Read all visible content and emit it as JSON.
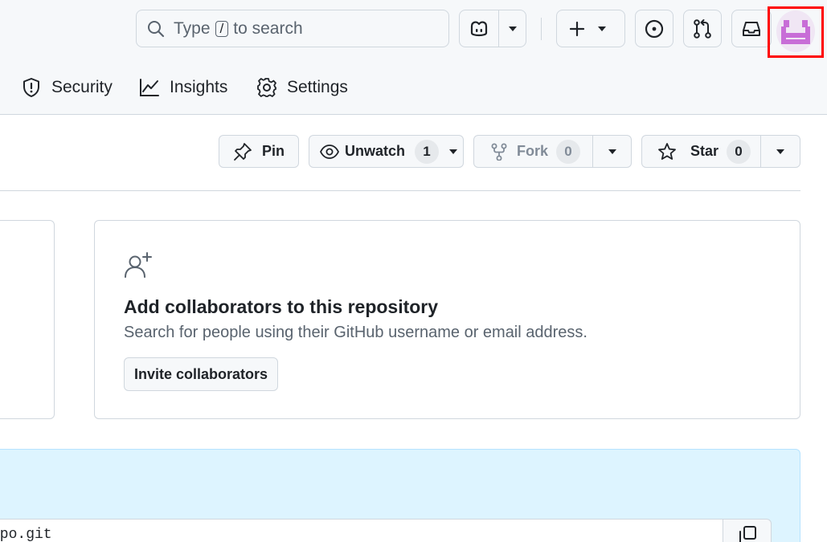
{
  "header": {
    "search": {
      "text_before": "Type",
      "key": "/",
      "text_after": "to search"
    },
    "nav": {
      "security": "Security",
      "insights": "Insights",
      "settings": "Settings"
    },
    "icons": {
      "copilot": "copilot-icon",
      "create": "plus-icon",
      "issues": "issue-opened-icon",
      "pulls": "git-pull-request-icon",
      "inbox": "inbox-icon"
    },
    "avatar_color": "#c86dd7",
    "highlight_color": "#ff0000"
  },
  "repo_actions": {
    "pin": "Pin",
    "unwatch": "Unwatch",
    "watch_count": "1",
    "fork": "Fork",
    "fork_count": "0",
    "star": "Star",
    "star_count": "0"
  },
  "collaborators": {
    "title": "Add collaborators to this repository",
    "description": "Search for people using their GitHub username or email address.",
    "button": "Invite collaborators"
  },
  "clone": {
    "url_visible": "epo.git"
  }
}
